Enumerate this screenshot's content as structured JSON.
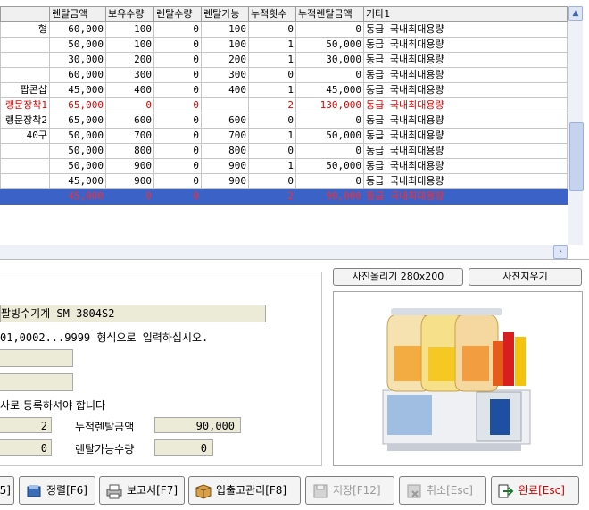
{
  "grid": {
    "columns": [
      "",
      "렌탈금액",
      "보유수량",
      "렌탈수량",
      "렌탈가능",
      "누적횟수",
      "누적렌탈금액",
      "기타1"
    ],
    "rows": [
      {
        "name": "형",
        "price": "60,000",
        "stock": "100",
        "rented": "0",
        "avail": "100",
        "count": "0",
        "total": "0",
        "etc": "동급 국내최대용량",
        "style": "normal"
      },
      {
        "name": "",
        "price": "50,000",
        "stock": "100",
        "rented": "0",
        "avail": "100",
        "count": "1",
        "total": "50,000",
        "etc": "동급 국내최대용량",
        "style": "normal"
      },
      {
        "name": "",
        "price": "30,000",
        "stock": "200",
        "rented": "0",
        "avail": "200",
        "count": "1",
        "total": "30,000",
        "etc": "동급 국내최대용량",
        "style": "normal"
      },
      {
        "name": "",
        "price": "60,000",
        "stock": "300",
        "rented": "0",
        "avail": "300",
        "count": "0",
        "total": "0",
        "etc": "동급 국내최대용량",
        "style": "normal"
      },
      {
        "name": "팝콘샵",
        "price": "45,000",
        "stock": "400",
        "rented": "0",
        "avail": "400",
        "count": "1",
        "total": "45,000",
        "etc": "동급 국내최대용량",
        "style": "normal"
      },
      {
        "name": "랭문장착1",
        "price": "65,000",
        "stock": "0",
        "rented": "0",
        "avail": "",
        "count": "2",
        "total": "130,000",
        "etc": "동급 국내최대용량",
        "style": "red"
      },
      {
        "name": "랭문장착2",
        "price": "65,000",
        "stock": "600",
        "rented": "0",
        "avail": "600",
        "count": "0",
        "total": "0",
        "etc": "동급 국내최대용량",
        "style": "normal"
      },
      {
        "name": "40구",
        "price": "50,000",
        "stock": "700",
        "rented": "0",
        "avail": "700",
        "count": "1",
        "total": "50,000",
        "etc": "동급 국내최대용량",
        "style": "normal"
      },
      {
        "name": "",
        "price": "50,000",
        "stock": "800",
        "rented": "0",
        "avail": "800",
        "count": "0",
        "total": "0",
        "etc": "동급 국내최대용량",
        "style": "normal"
      },
      {
        "name": "",
        "price": "50,000",
        "stock": "900",
        "rented": "0",
        "avail": "900",
        "count": "1",
        "total": "50,000",
        "etc": "동급 국내최대용량",
        "style": "normal"
      },
      {
        "name": "",
        "price": "45,000",
        "stock": "900",
        "rented": "0",
        "avail": "900",
        "count": "0",
        "total": "0",
        "etc": "동급 국내최대용량",
        "style": "normal"
      },
      {
        "name": "",
        "price": "45,000",
        "stock": "0",
        "rented": "0",
        "avail": "",
        "count": "2",
        "total": "90,000",
        "etc": "동급 국내최대용량",
        "style": "sel"
      }
    ]
  },
  "detail": {
    "model_value": "팔빙수기계-SM-3804S2",
    "hint_text": "01,0002...9999 형식으로 입력하십시오.",
    "register_note": "사로 등록하셔야 합니다",
    "rental_count_value": "2",
    "total_rental_label": "누적렌탈금액",
    "total_rental_value": "90,000",
    "stock_value": "0",
    "available_label": "렌탈가능수량",
    "available_value": "0"
  },
  "photo": {
    "upload_label": "사진올리기 280x200",
    "delete_label": "사진지우기"
  },
  "toolbar": {
    "f5_label": "5]",
    "sort_label": "정렬[F6]",
    "report_label": "보고서[F7]",
    "inout_label": "입출고관리[F8]",
    "save_label": "저장[F12]",
    "cancel_label": "취소[Esc]",
    "done_label": "완료[Esc]"
  },
  "colors": {
    "selection": "#3b63c7",
    "red_text": "#e00000",
    "field_bg": "#ecebd8"
  }
}
